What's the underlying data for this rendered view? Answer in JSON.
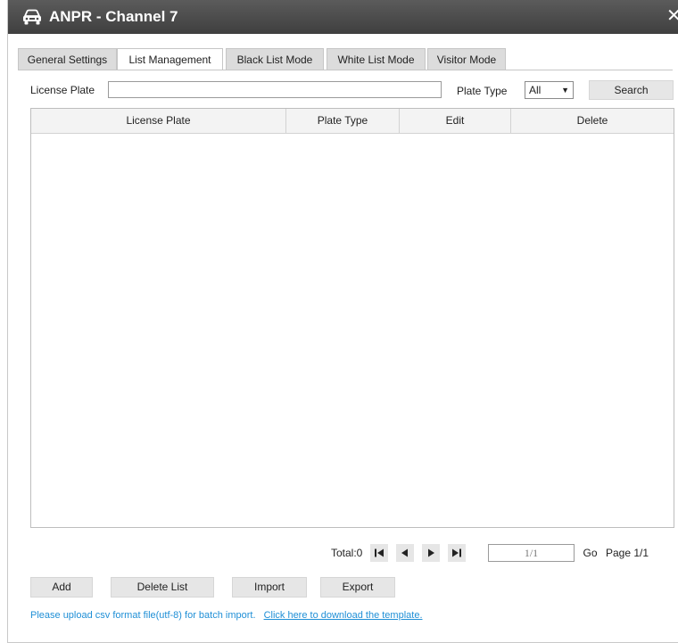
{
  "window": {
    "title": "ANPR - Channel 7",
    "close_glyph": "✕",
    "title_icon": "car-icon"
  },
  "tabs": [
    {
      "label": "General Settings",
      "active": false
    },
    {
      "label": "List Management",
      "active": true
    },
    {
      "label": "Black List Mode",
      "active": false
    },
    {
      "label": "White List Mode",
      "active": false
    },
    {
      "label": "Visitor Mode",
      "active": false
    }
  ],
  "search": {
    "license_plate_label": "License Plate",
    "license_plate_value": "",
    "plate_type_label": "Plate Type",
    "plate_type_selected": "All",
    "search_button": "Search"
  },
  "table": {
    "columns": [
      "License Plate",
      "Plate Type",
      "Edit",
      "Delete"
    ],
    "rows": []
  },
  "pagination": {
    "total_label": "Total:0",
    "page_input": "1/1",
    "go_button": "Go",
    "page_label": "Page 1/1"
  },
  "actions": {
    "add": "Add",
    "delete_list": "Delete List",
    "import": "Import",
    "export": "Export"
  },
  "hint": {
    "text": "Please upload csv format file(utf-8) for batch import.",
    "link": "Click here to download the template."
  },
  "colors": {
    "titlebar": "#4a4a4a",
    "hint": "#1f8fd6"
  }
}
